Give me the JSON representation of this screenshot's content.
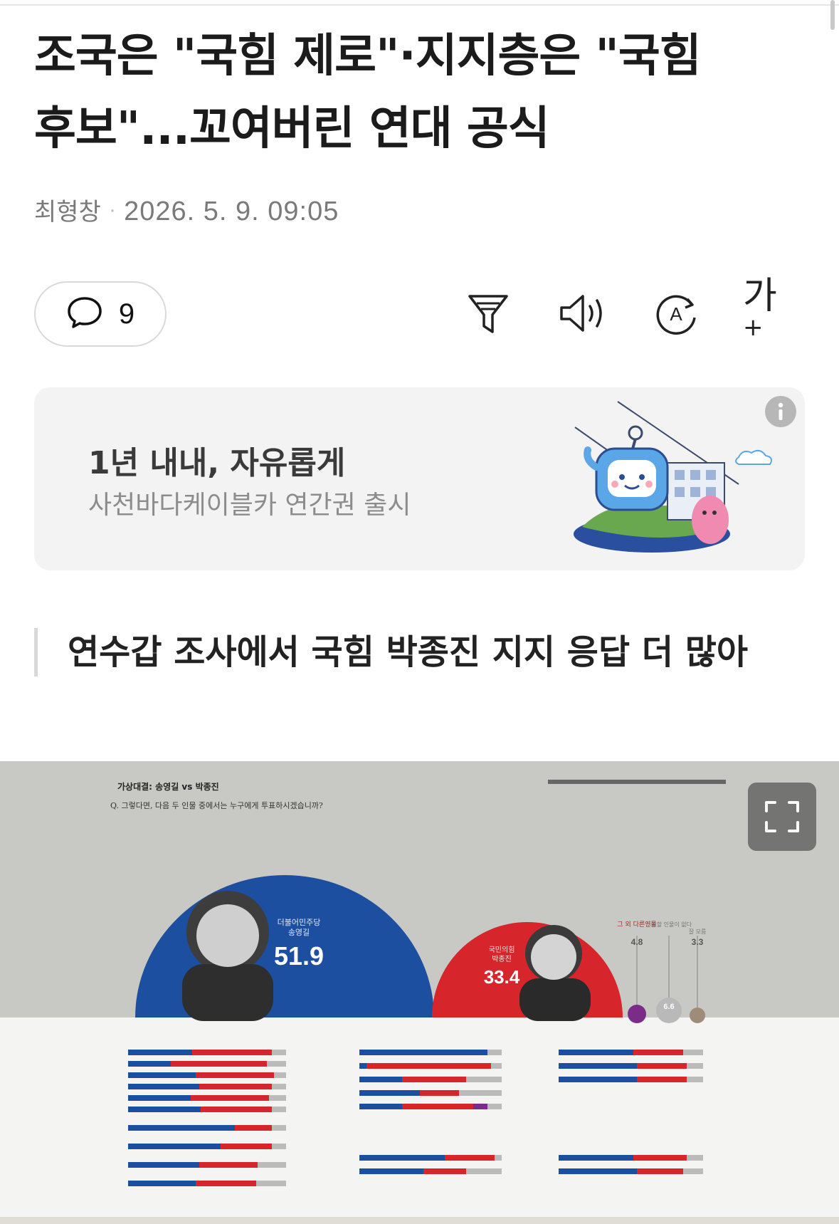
{
  "article": {
    "headline_line1": "조국은 \"국힘 제로\"·지지층은 \"국힘",
    "headline_line2": "후보\"...꼬여버린 연대 공식",
    "author": "최형창",
    "separator": "·",
    "date": "2026. 5. 9. 09:05",
    "subheading": "연수갑 조사에서 국힘 박종진 지지 응답 더 많아"
  },
  "toolbar": {
    "comment_count": "9",
    "font_label": "가",
    "font_plus": "+"
  },
  "ad": {
    "title": "1년 내내, 자유롭게",
    "subtitle": "사천바다케이블카 연간권 출시",
    "info_icon": "i"
  },
  "chart_image": {
    "header_title": "가상대결: 송영길 vs 박종진",
    "question": "Q. 그렇다면, 다음 두 인물 중에서는 누구에게 투표하시겠습니까?",
    "candidate1_party": "더불어민주당",
    "candidate1_name": "송영길",
    "candidate1_value": "51.9",
    "candidate2_party": "국민의힘",
    "candidate2_name": "박종진",
    "candidate2_value": "33.4",
    "other_label": "그 외 다른인물",
    "other_value": "4.8",
    "none_label": "투표할 인물이 없다",
    "none_value": "6.6",
    "dk_label": "잘 모름",
    "dk_value": "3.3",
    "colors": {
      "democratic_blue": "#1d4fa0",
      "ppp_red": "#d6252b",
      "other_purple": "#7a2c86",
      "background_gray": "#c8c8c4"
    },
    "chart_data": {
      "type": "bar",
      "categories": [
        "송영길",
        "박종진",
        "그 외 다른인물",
        "투표할 인물이 없다",
        "잘 모름"
      ],
      "values": [
        51.9,
        33.4,
        4.8,
        6.6,
        3.3
      ]
    }
  },
  "icons": {
    "comment": "comment-bubble-icon",
    "filter": "filter-icon",
    "speaker": "speaker-icon",
    "translate": "translate-icon",
    "font_size": "font-size-icon",
    "expand": "expand-icon",
    "info": "info-icon"
  }
}
